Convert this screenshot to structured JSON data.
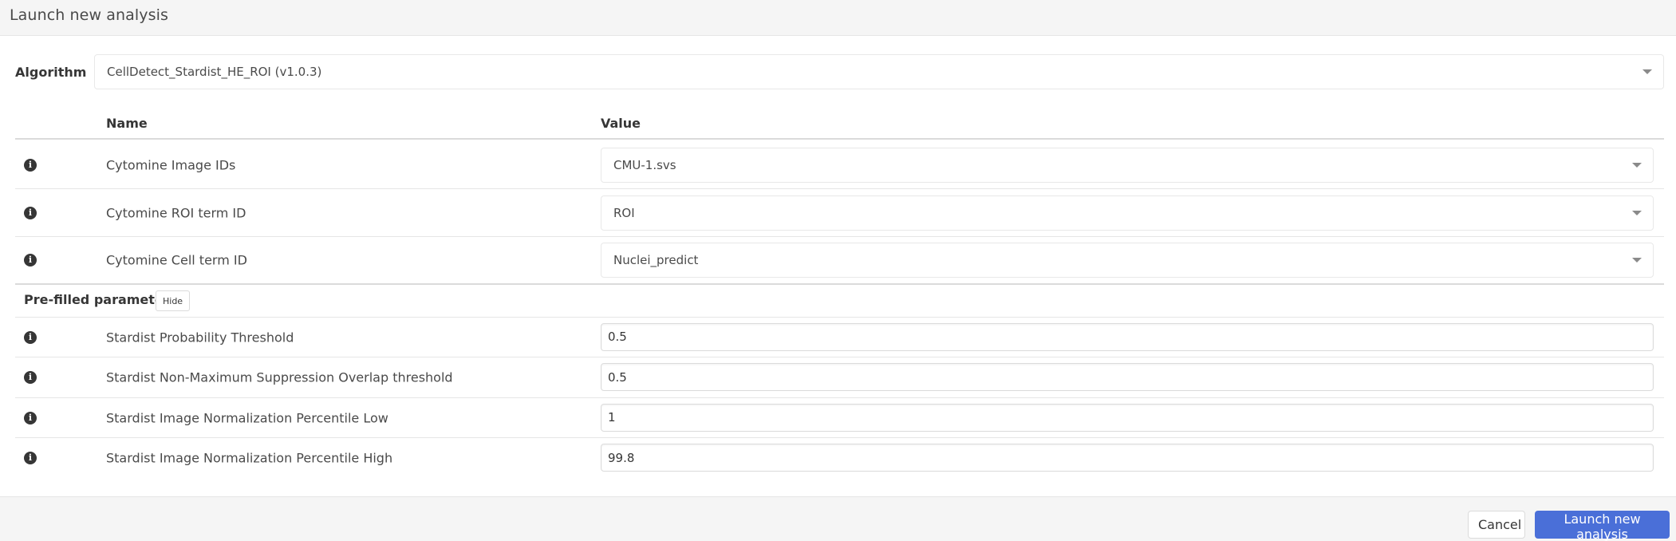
{
  "modal": {
    "title": "Launch new analysis"
  },
  "algorithm": {
    "label": "Algorithm",
    "selected": "CellDetect_Stardist_HE_ROI (v1.0.3)"
  },
  "table": {
    "columns": [
      "Name",
      "Value"
    ],
    "required_params": [
      {
        "name": "Cytomine Image IDs",
        "value": "CMU-1.svs",
        "type": "select"
      },
      {
        "name": "Cytomine ROI term ID",
        "value": "ROI",
        "type": "select"
      },
      {
        "name": "Cytomine Cell term ID",
        "value": "Nuclei_predict",
        "type": "select"
      }
    ],
    "prefilled": {
      "label": "Pre-filled parameters",
      "toggle_label": "Hide",
      "params": [
        {
          "name": "Stardist Probability Threshold",
          "value": "0.5"
        },
        {
          "name": "Stardist Non-Maximum Suppression Overlap threshold",
          "value": "0.5"
        },
        {
          "name": "Stardist Image Normalization Percentile Low",
          "value": "1"
        },
        {
          "name": "Stardist Image Normalization Percentile High",
          "value": "99.8"
        }
      ]
    }
  },
  "icons": {
    "info": "info-circle-icon",
    "caret": "caret-down-icon",
    "info_glyph": "i"
  },
  "footer": {
    "cancel_label": "Cancel",
    "launch_label": "Launch new analysis"
  },
  "colors": {
    "primary": "#4a6fd8",
    "header_bg": "#f5f5f5"
  }
}
